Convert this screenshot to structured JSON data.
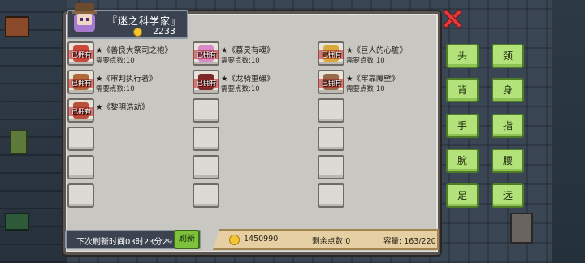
{
  "character": {
    "name": "『迷之科学家』",
    "coins": "2233"
  },
  "items": [
    {
      "name": "★《善良大祭司之袍》",
      "cost": "需要点数:10",
      "badge": "已拥有",
      "owned": true,
      "color": "#c94a3a"
    },
    {
      "name": "★《慕灵有魂》",
      "cost": "需要点数:10",
      "badge": "已拥有",
      "owned": true,
      "color": "#d88ac8"
    },
    {
      "name": "★《巨人的心脏》",
      "cost": "需要点数:10",
      "badge": "已拥有",
      "owned": true,
      "color": "#d9a93a"
    },
    {
      "name": "★《审判执行者》",
      "cost": "需要点数:10",
      "badge": "已拥有",
      "owned": true,
      "color": "#b36a3a"
    },
    {
      "name": "★《龙骑重碾》",
      "cost": "需要点数:10",
      "badge": "已拥有",
      "owned": true,
      "color": "#7a2a2a"
    },
    {
      "name": "★《牢靠障壁》",
      "cost": "需要点数:10",
      "badge": "已拥有",
      "owned": true,
      "color": "#9a6b4a"
    },
    {
      "name": "★《黎明浩劫》",
      "cost": "",
      "badge": "已拥有",
      "owned": true,
      "color": "#b8503a"
    },
    {
      "name": "",
      "cost": "",
      "badge": "",
      "owned": false
    },
    {
      "name": "",
      "cost": "",
      "badge": "",
      "owned": false
    },
    {
      "name": "",
      "cost": "",
      "badge": "",
      "owned": false
    },
    {
      "name": "",
      "cost": "",
      "badge": "",
      "owned": false
    },
    {
      "name": "",
      "cost": "",
      "badge": "",
      "owned": false
    },
    {
      "name": "",
      "cost": "",
      "badge": "",
      "owned": false
    },
    {
      "name": "",
      "cost": "",
      "badge": "",
      "owned": false
    },
    {
      "name": "",
      "cost": "",
      "badge": "",
      "owned": false
    },
    {
      "name": "",
      "cost": "",
      "badge": "",
      "owned": false
    },
    {
      "name": "",
      "cost": "",
      "badge": "",
      "owned": false
    },
    {
      "name": "",
      "cost": "",
      "badge": "",
      "owned": false
    }
  ],
  "footer": {
    "refresh_text": "下次刷新时间03时23分29",
    "refresh_button": "刷新",
    "points_total": "1450990",
    "points_remaining": "剩余点数:0",
    "capacity": "容量: 163/220"
  },
  "categories": [
    "头",
    "颈",
    "背",
    "身",
    "手",
    "指",
    "腕",
    "腰",
    "足",
    "远"
  ]
}
